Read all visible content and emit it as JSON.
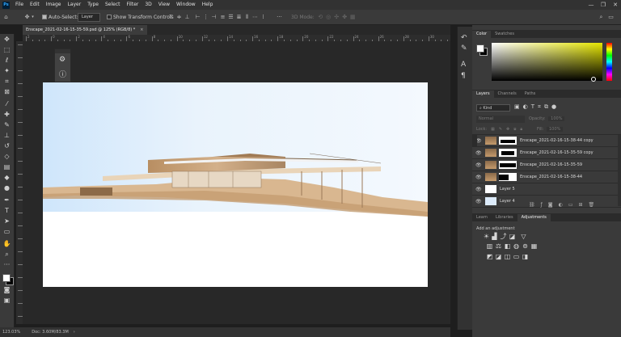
{
  "menubar": {
    "logo": "Ps",
    "items": [
      "File",
      "Edit",
      "Image",
      "Layer",
      "Type",
      "Select",
      "Filter",
      "3D",
      "View",
      "Window",
      "Help"
    ],
    "minimize": "—",
    "restore": "❐",
    "close": "✕"
  },
  "options": {
    "auto_select_label": "Auto-Select:",
    "auto_select_value": "Layer",
    "transform_label": "Show Transform Controls",
    "mode_3d_label": "3D Mode:"
  },
  "document": {
    "tab_title": "Enscape_2021-02-16-15-35-59.psd @ 125% (RGB/8) *",
    "tab_close": "×"
  },
  "ruler": {
    "h_numbers": [
      "2",
      "0",
      "2",
      "4",
      "6",
      "8",
      "10",
      "12",
      "14",
      "16",
      "18",
      "20",
      "22",
      "24",
      "26",
      "28",
      "30"
    ]
  },
  "status": {
    "zoom": "123.03%",
    "doc_size": "Doc: 3.60M/83.3M",
    "arrow": "›"
  },
  "color_panel": {
    "tabs": [
      "Color",
      "Swatches"
    ],
    "active_tab": "Color"
  },
  "layers_panel": {
    "tabs": [
      "Layers",
      "Channels",
      "Paths"
    ],
    "active_tab": "Layers",
    "filter_label": "Kind",
    "blend_mode": "Normal",
    "opacity_label": "Opacity:",
    "opacity_value": "100%",
    "lock_label": "Lock:",
    "fill_label": "Fill:",
    "fill_value": "100%",
    "layers": [
      {
        "name": "Enscape_2021-02-16-15-38-44 copy",
        "has_mask": true,
        "thumb": "photo"
      },
      {
        "name": "Enscape_2021-02-16-15-35-59 copy",
        "has_mask": true,
        "thumb": "photo"
      },
      {
        "name": "Enscape_2021-02-16-15-35-59",
        "has_mask": true,
        "thumb": "photo"
      },
      {
        "name": "Enscape_2021-02-16-15-38-44",
        "has_mask": true,
        "thumb": "photo"
      },
      {
        "name": "Layer 5",
        "has_mask": false,
        "thumb": "white"
      },
      {
        "name": "Layer 4",
        "has_mask": false,
        "thumb": "sky"
      }
    ]
  },
  "adjust_panel": {
    "tabs": [
      "Learn",
      "Libraries",
      "Adjustments"
    ],
    "active_tab": "Adjustments",
    "add_label": "Add an adjustment"
  },
  "colors": {
    "chrome": "#3a3a3a",
    "accent": "#31a8ff"
  }
}
